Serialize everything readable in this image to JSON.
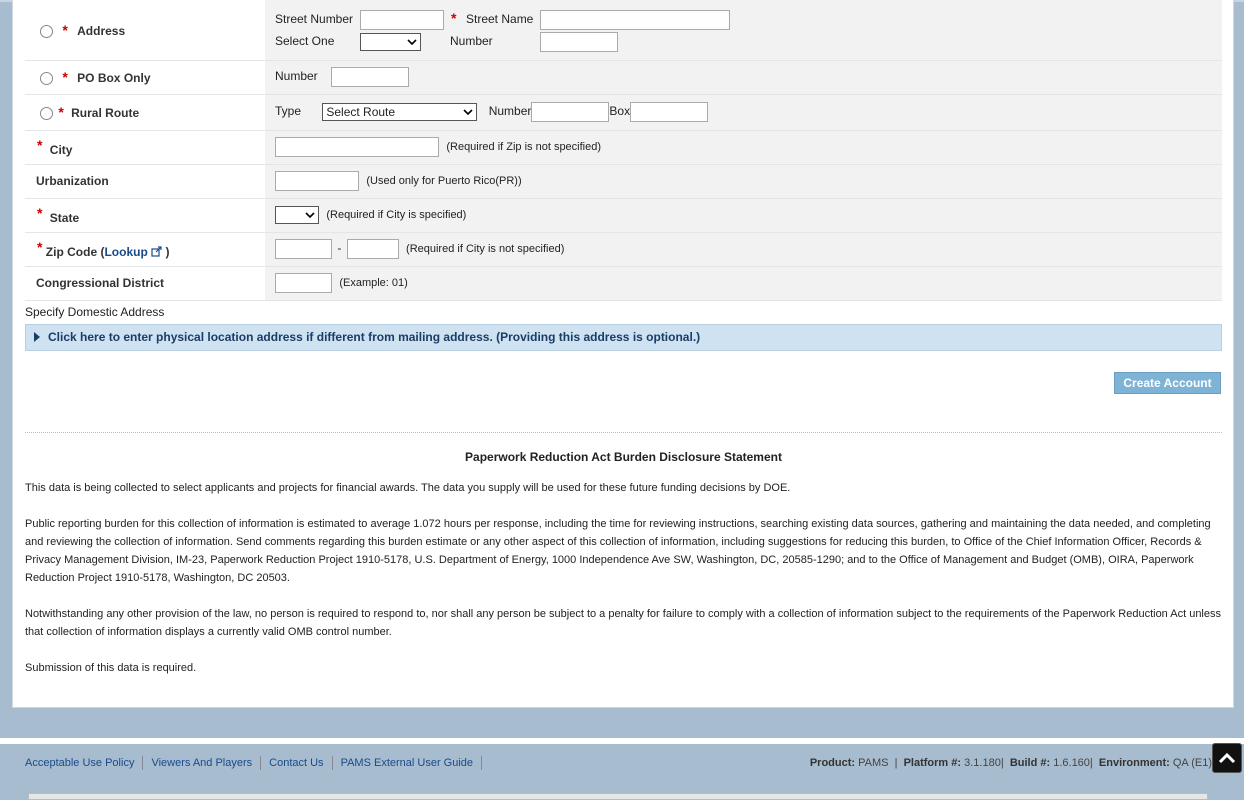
{
  "form": {
    "address_label": "Address",
    "street_number_label": "Street Number",
    "street_name_label": "Street Name",
    "select_one_label": "Select One",
    "number_label": "Number",
    "po_box_label": "PO Box Only",
    "po_number_label": "Number",
    "rural_route_label": "Rural Route",
    "type_label": "Type",
    "route_select": "Select Route",
    "rr_number_label": "Number",
    "box_label": "Box",
    "city_label": "City",
    "city_hint": "(Required if Zip is not specified)",
    "urbanization_label": "Urbanization",
    "urbanization_hint": "(Used only for Puerto Rico(PR))",
    "state_label": "State",
    "state_hint": "(Required if City is specified)",
    "zip_label": "Zip Code (",
    "zip_lookup": "Lookup",
    "zip_close": " )",
    "zip_dash": "-",
    "zip_hint": "(Required if City is not specified)",
    "congressional_label": "Congressional District",
    "congressional_hint": "(Example: 01)"
  },
  "specify_text": "Specify Domestic Address",
  "expander_text": "Click here to enter physical location address if different from mailing address. (Providing this address is optional.)",
  "create_button": "Create Account",
  "prd": {
    "title": "Paperwork Reduction Act Burden Disclosure Statement",
    "p1": "This data is being collected to select applicants and projects for financial awards. The data you supply will be used for these future funding decisions by DOE.",
    "p2": "Public reporting burden for this collection of information is estimated to average 1.072 hours per response, including the time for reviewing instructions, searching existing data sources, gathering and maintaining the data needed, and completing and reviewing the collection of information. Send comments regarding this burden estimate or any other aspect of this collection of information, including suggestions for reducing this burden, to Office of the Chief Information Officer, Records & Privacy Management Division, IM-23, Paperwork Reduction Project 1910-5178, U.S. Department of Energy, 1000 Independence Ave SW, Washington, DC, 20585-1290; and to the Office of Management and Budget (OMB), OIRA, Paperwork Reduction Project 1910-5178, Washington, DC 20503.",
    "p3": "Notwithstanding any other provision of the law, no person is required to respond to, nor shall any person be subject to a penalty for failure to comply with a collection of information subject to the requirements of the Paperwork Reduction Act unless that collection of information displays a currently valid OMB control number.",
    "p4": "Submission of this data is required."
  },
  "footer": {
    "links": [
      "Acceptable Use Policy",
      "Viewers And Players",
      "Contact Us",
      "PAMS External User Guide"
    ],
    "product_label": "Product:",
    "product_value": "PAMS",
    "platform_label": "Platform #:",
    "platform_value": "3.1.180",
    "build_label": "Build #:",
    "build_value": "1.6.160",
    "env_label": "Environment:",
    "env_value": "QA (E1)",
    "sep": "|"
  },
  "icons": {
    "scroll_top": "chevron-up-icon",
    "external": "external-link-icon",
    "expand": "triangle-right-icon"
  }
}
